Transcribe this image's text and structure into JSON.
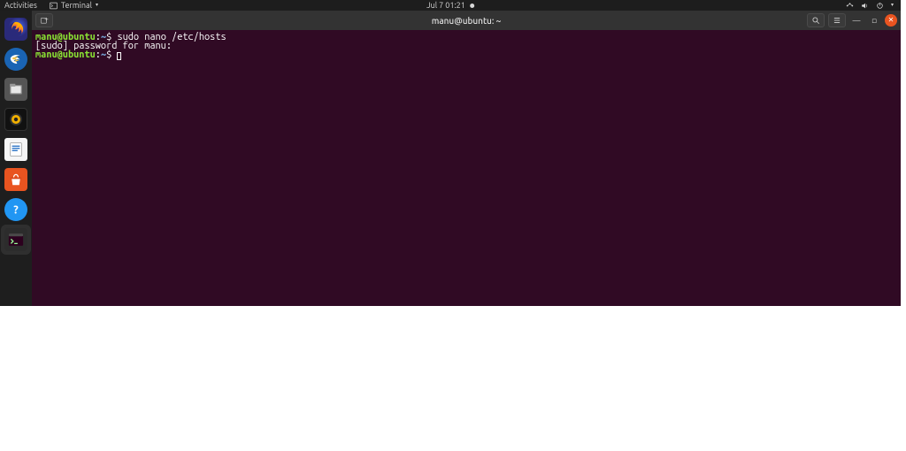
{
  "topbar": {
    "activities": "Activities",
    "app_label": "Terminal",
    "clock": "Jul 7  01:21"
  },
  "dock": {
    "tooltip": "Terminal"
  },
  "window": {
    "title": "manu@ubuntu: ~"
  },
  "terminal": {
    "lines": [
      {
        "user": "manu@ubuntu",
        "sep1": ":",
        "path": "~",
        "sep2": "$ ",
        "cmd": "sudo nano /etc/hosts"
      },
      {
        "plain": "[sudo] password for manu: "
      },
      {
        "user": "manu@ubuntu",
        "sep1": ":",
        "path": "~",
        "sep2": "$ ",
        "cmd": ""
      }
    ]
  }
}
